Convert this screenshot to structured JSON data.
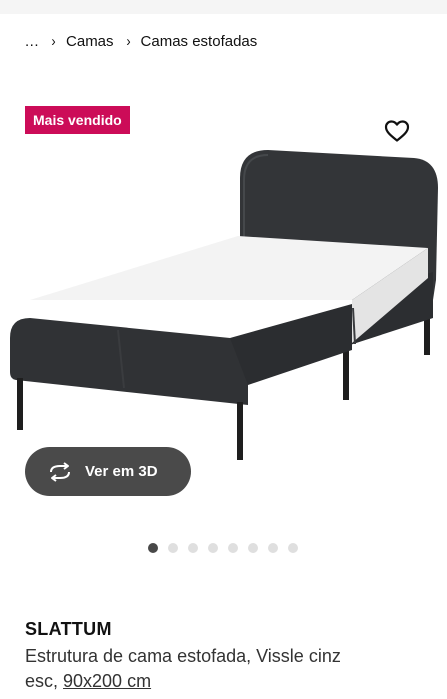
{
  "breadcrumb": {
    "ellipsis": "...",
    "items": [
      "Camas",
      "Camas estofadas"
    ]
  },
  "badge": {
    "label": "Mais vendido"
  },
  "gallery": {
    "view_3d_label": "Ver em 3D",
    "dot_count": 8,
    "active_index": 0
  },
  "product": {
    "name": "SLATTUM",
    "description_line1": "Estrutura de cama estofada, Vissle cinz",
    "description_line2_prefix": "esc, ",
    "size_link": "90x200 cm"
  },
  "colors": {
    "badge_bg": "#cc0c58",
    "view3d_bg": "#4a4a4a",
    "dot_active": "#484848",
    "dot_inactive": "#dfdfdf"
  }
}
